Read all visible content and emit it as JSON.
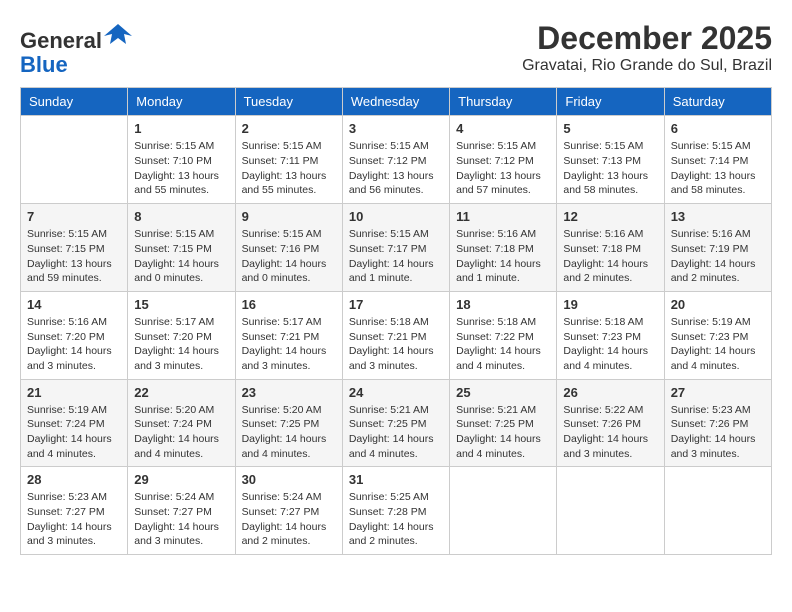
{
  "header": {
    "logo_general": "General",
    "logo_blue": "Blue",
    "month": "December 2025",
    "location": "Gravatai, Rio Grande do Sul, Brazil"
  },
  "days_of_week": [
    "Sunday",
    "Monday",
    "Tuesday",
    "Wednesday",
    "Thursday",
    "Friday",
    "Saturday"
  ],
  "weeks": [
    [
      {
        "day": "",
        "info": ""
      },
      {
        "day": "1",
        "info": "Sunrise: 5:15 AM\nSunset: 7:10 PM\nDaylight: 13 hours\nand 55 minutes."
      },
      {
        "day": "2",
        "info": "Sunrise: 5:15 AM\nSunset: 7:11 PM\nDaylight: 13 hours\nand 55 minutes."
      },
      {
        "day": "3",
        "info": "Sunrise: 5:15 AM\nSunset: 7:12 PM\nDaylight: 13 hours\nand 56 minutes."
      },
      {
        "day": "4",
        "info": "Sunrise: 5:15 AM\nSunset: 7:12 PM\nDaylight: 13 hours\nand 57 minutes."
      },
      {
        "day": "5",
        "info": "Sunrise: 5:15 AM\nSunset: 7:13 PM\nDaylight: 13 hours\nand 58 minutes."
      },
      {
        "day": "6",
        "info": "Sunrise: 5:15 AM\nSunset: 7:14 PM\nDaylight: 13 hours\nand 58 minutes."
      }
    ],
    [
      {
        "day": "7",
        "info": "Sunrise: 5:15 AM\nSunset: 7:15 PM\nDaylight: 13 hours\nand 59 minutes."
      },
      {
        "day": "8",
        "info": "Sunrise: 5:15 AM\nSunset: 7:15 PM\nDaylight: 14 hours\nand 0 minutes."
      },
      {
        "day": "9",
        "info": "Sunrise: 5:15 AM\nSunset: 7:16 PM\nDaylight: 14 hours\nand 0 minutes."
      },
      {
        "day": "10",
        "info": "Sunrise: 5:15 AM\nSunset: 7:17 PM\nDaylight: 14 hours\nand 1 minute."
      },
      {
        "day": "11",
        "info": "Sunrise: 5:16 AM\nSunset: 7:18 PM\nDaylight: 14 hours\nand 1 minute."
      },
      {
        "day": "12",
        "info": "Sunrise: 5:16 AM\nSunset: 7:18 PM\nDaylight: 14 hours\nand 2 minutes."
      },
      {
        "day": "13",
        "info": "Sunrise: 5:16 AM\nSunset: 7:19 PM\nDaylight: 14 hours\nand 2 minutes."
      }
    ],
    [
      {
        "day": "14",
        "info": "Sunrise: 5:16 AM\nSunset: 7:20 PM\nDaylight: 14 hours\nand 3 minutes."
      },
      {
        "day": "15",
        "info": "Sunrise: 5:17 AM\nSunset: 7:20 PM\nDaylight: 14 hours\nand 3 minutes."
      },
      {
        "day": "16",
        "info": "Sunrise: 5:17 AM\nSunset: 7:21 PM\nDaylight: 14 hours\nand 3 minutes."
      },
      {
        "day": "17",
        "info": "Sunrise: 5:18 AM\nSunset: 7:21 PM\nDaylight: 14 hours\nand 3 minutes."
      },
      {
        "day": "18",
        "info": "Sunrise: 5:18 AM\nSunset: 7:22 PM\nDaylight: 14 hours\nand 4 minutes."
      },
      {
        "day": "19",
        "info": "Sunrise: 5:18 AM\nSunset: 7:23 PM\nDaylight: 14 hours\nand 4 minutes."
      },
      {
        "day": "20",
        "info": "Sunrise: 5:19 AM\nSunset: 7:23 PM\nDaylight: 14 hours\nand 4 minutes."
      }
    ],
    [
      {
        "day": "21",
        "info": "Sunrise: 5:19 AM\nSunset: 7:24 PM\nDaylight: 14 hours\nand 4 minutes."
      },
      {
        "day": "22",
        "info": "Sunrise: 5:20 AM\nSunset: 7:24 PM\nDaylight: 14 hours\nand 4 minutes."
      },
      {
        "day": "23",
        "info": "Sunrise: 5:20 AM\nSunset: 7:25 PM\nDaylight: 14 hours\nand 4 minutes."
      },
      {
        "day": "24",
        "info": "Sunrise: 5:21 AM\nSunset: 7:25 PM\nDaylight: 14 hours\nand 4 minutes."
      },
      {
        "day": "25",
        "info": "Sunrise: 5:21 AM\nSunset: 7:25 PM\nDaylight: 14 hours\nand 4 minutes."
      },
      {
        "day": "26",
        "info": "Sunrise: 5:22 AM\nSunset: 7:26 PM\nDaylight: 14 hours\nand 3 minutes."
      },
      {
        "day": "27",
        "info": "Sunrise: 5:23 AM\nSunset: 7:26 PM\nDaylight: 14 hours\nand 3 minutes."
      }
    ],
    [
      {
        "day": "28",
        "info": "Sunrise: 5:23 AM\nSunset: 7:27 PM\nDaylight: 14 hours\nand 3 minutes."
      },
      {
        "day": "29",
        "info": "Sunrise: 5:24 AM\nSunset: 7:27 PM\nDaylight: 14 hours\nand 3 minutes."
      },
      {
        "day": "30",
        "info": "Sunrise: 5:24 AM\nSunset: 7:27 PM\nDaylight: 14 hours\nand 2 minutes."
      },
      {
        "day": "31",
        "info": "Sunrise: 5:25 AM\nSunset: 7:28 PM\nDaylight: 14 hours\nand 2 minutes."
      },
      {
        "day": "",
        "info": ""
      },
      {
        "day": "",
        "info": ""
      },
      {
        "day": "",
        "info": ""
      }
    ]
  ]
}
